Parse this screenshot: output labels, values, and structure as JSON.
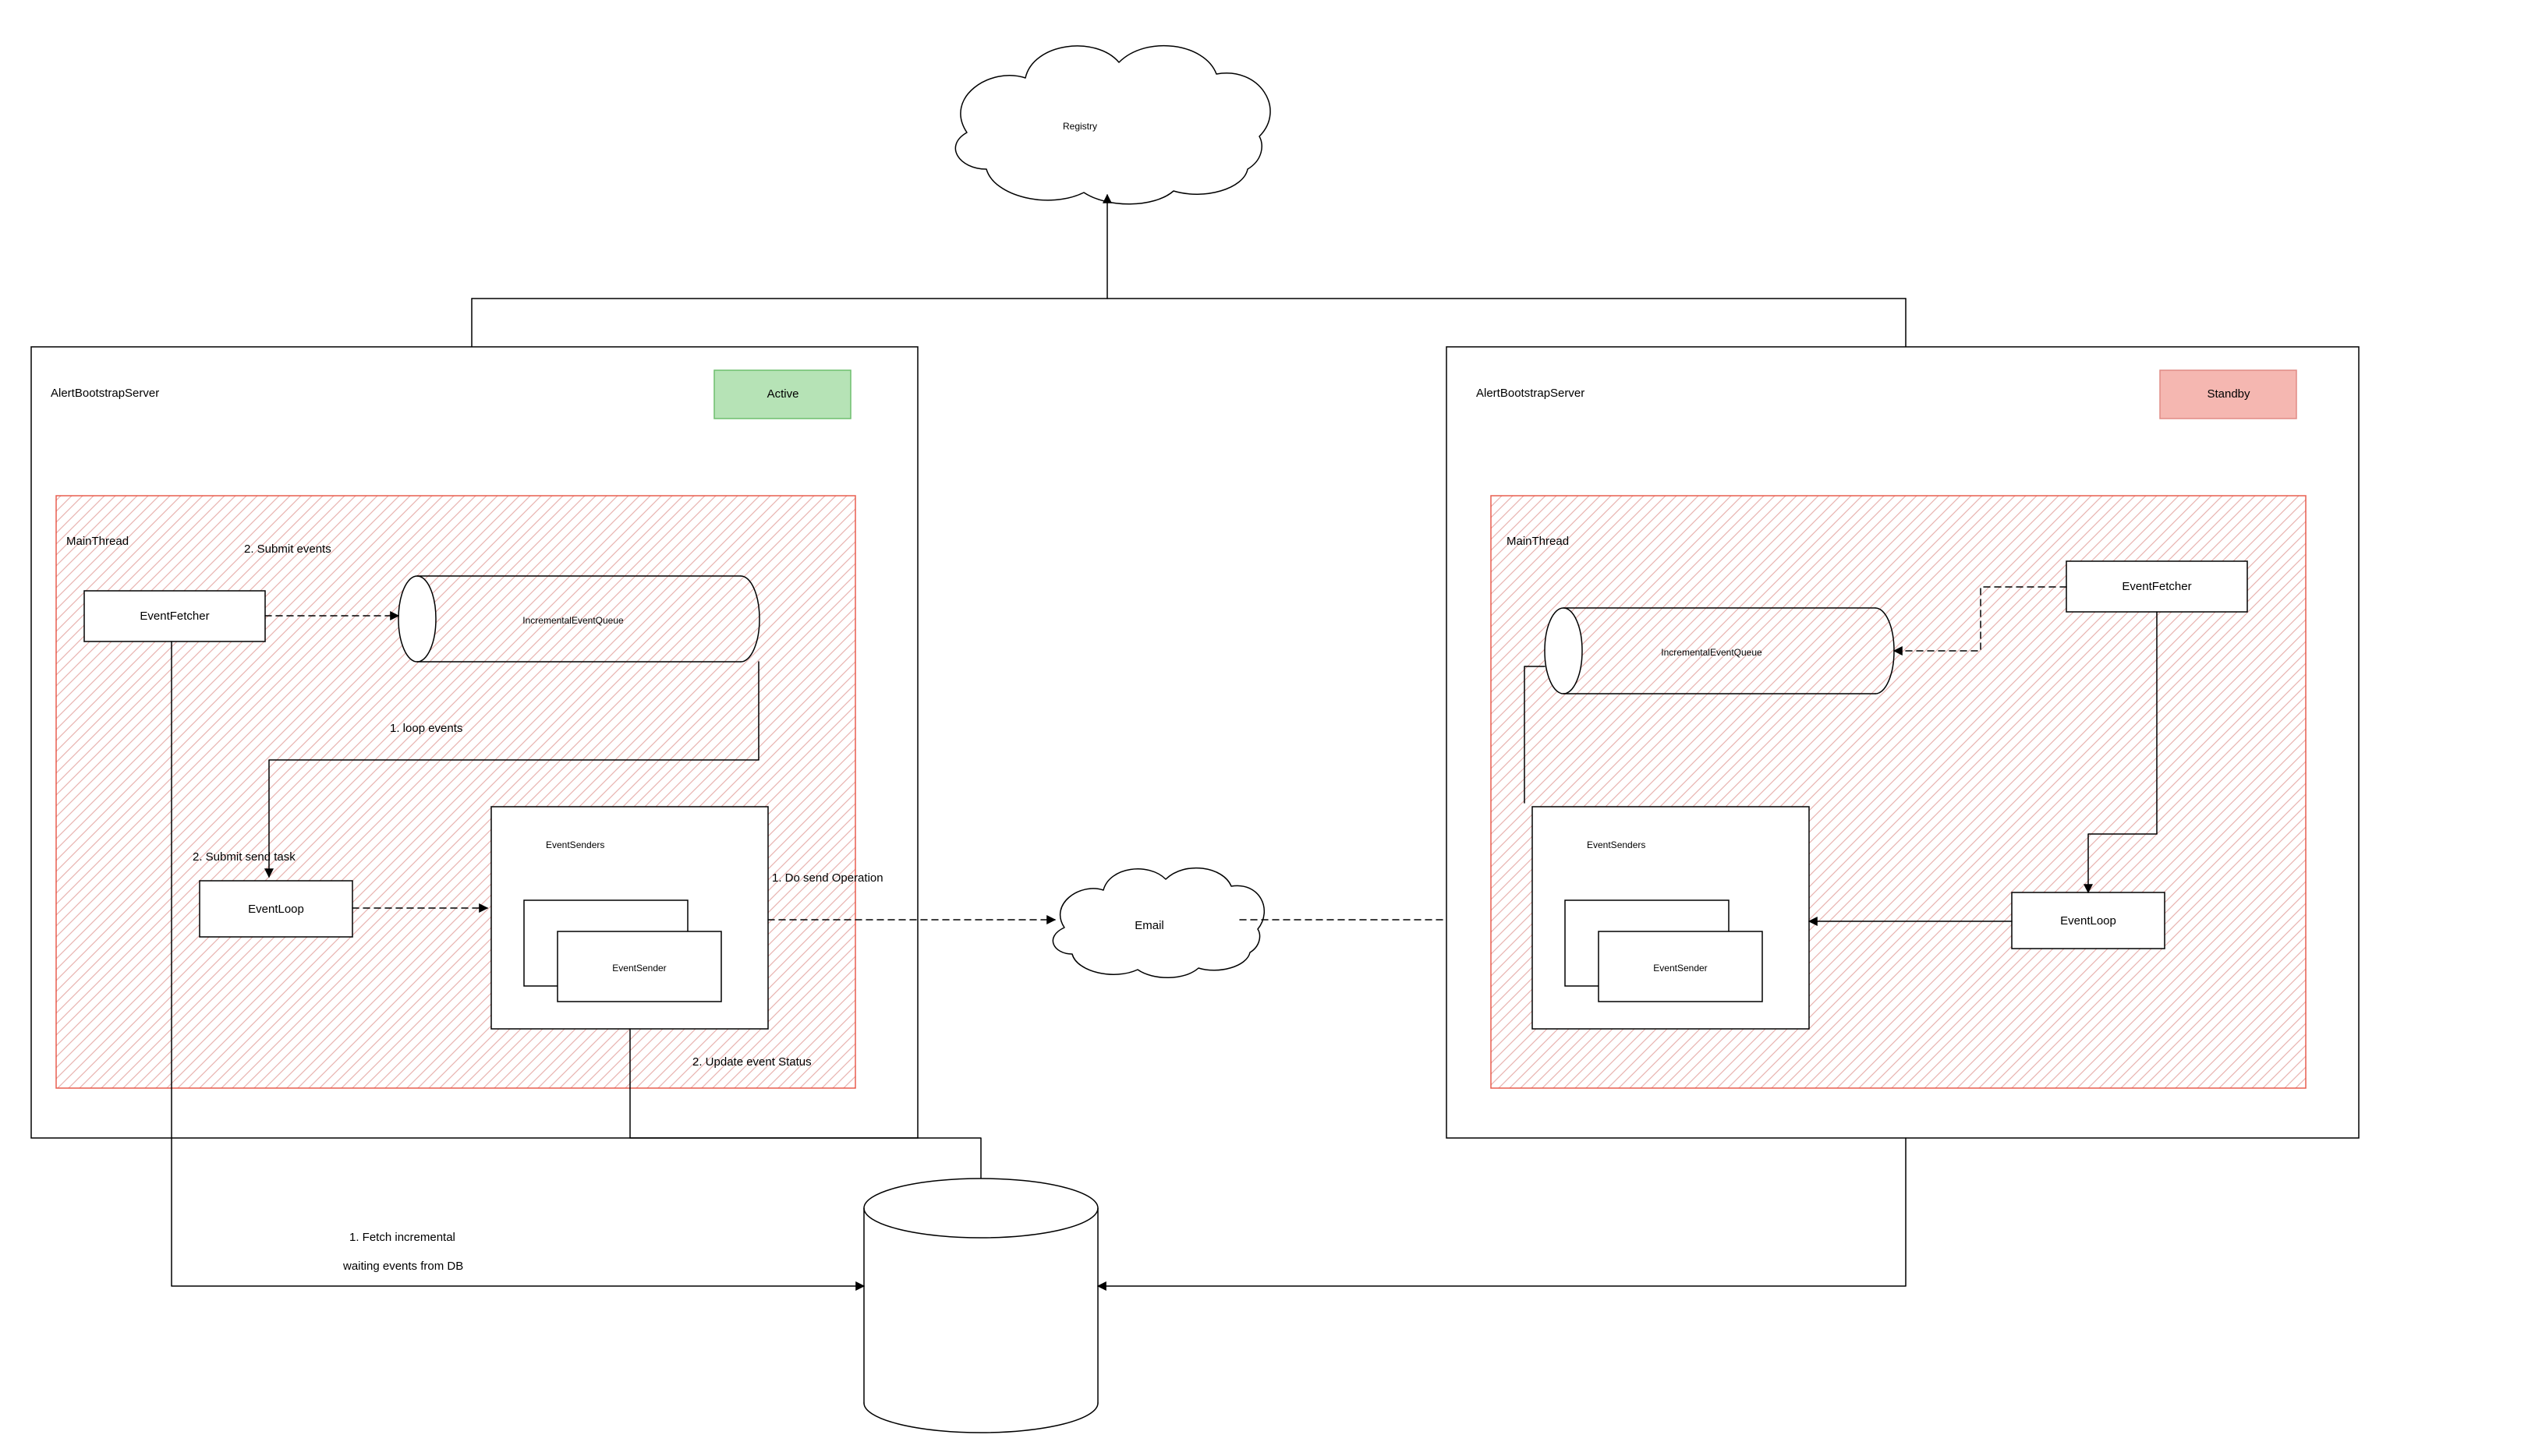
{
  "registry": {
    "label": "Registry"
  },
  "active_server": {
    "title": "AlertBootstrapServer",
    "status_label": "Active",
    "status_bg": "#b6e3b6",
    "status_border": "#6fbf6f",
    "mainthread_label": "MainThread",
    "event_fetcher_label": "EventFetcher",
    "queue_label": "IncrementalEventQueue",
    "submit_events_label": "2. Submit  events",
    "loop_events_label": "1. loop  events",
    "event_loop_label": "EventLoop",
    "submit_send_task_label": "2. Submit  send task",
    "event_senders_label": "EventSenders",
    "event_sender_label": "EventSender",
    "do_send_label": "1. Do send Operation",
    "update_status_label": "2. Update  event Status"
  },
  "standby_server": {
    "title": "AlertBootstrapServer",
    "status_label": "Standby",
    "status_bg": "#f5b7b1",
    "status_border": "#e08b85",
    "mainthread_label": "MainThread",
    "event_fetcher_label": "EventFetcher",
    "queue_label": "IncrementalEventQueue",
    "event_loop_label": "EventLoop",
    "event_senders_label": "EventSenders",
    "event_sender_label": "EventSender"
  },
  "email_label": "Email",
  "fetch_label_line1": "1. Fetch incremental",
  "fetch_label_line2": "waiting events from DB"
}
